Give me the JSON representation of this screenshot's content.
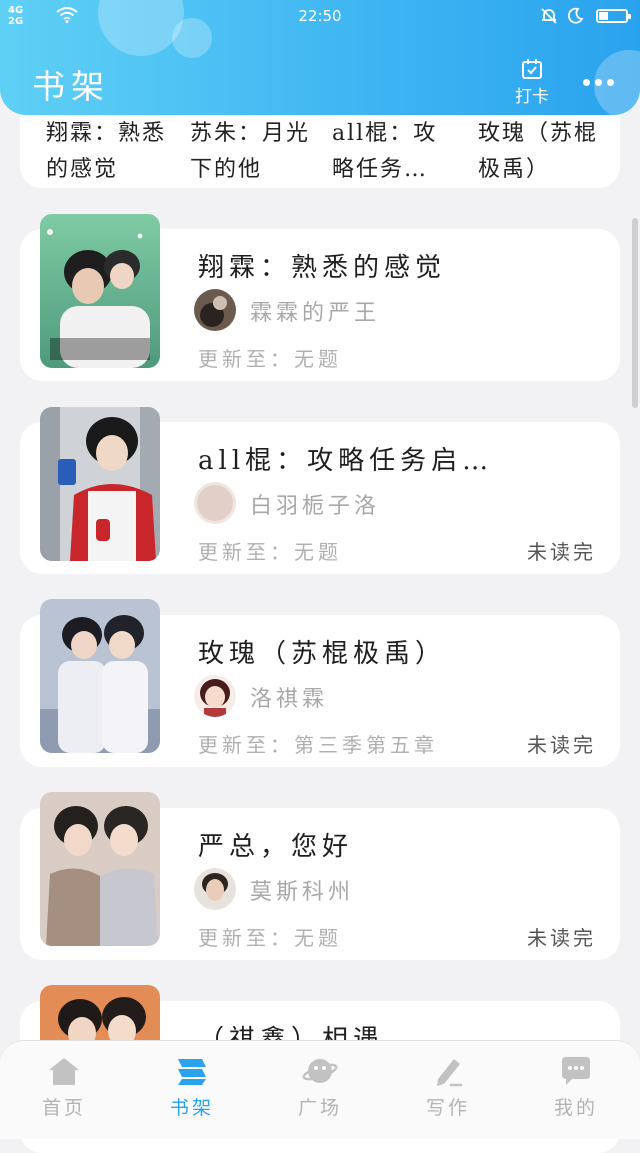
{
  "status": {
    "network": [
      "4G",
      "2G"
    ],
    "time": "22:50"
  },
  "header": {
    "title": "书架",
    "checkin_label": "打卡"
  },
  "top_partial": {
    "columns": [
      "翔霖：熟悉的感觉",
      "苏朱：月光下的他",
      "all棍：攻略任务…",
      "玫瑰（苏棍极禹）"
    ]
  },
  "books": [
    {
      "title": "翔霖：熟悉的感觉",
      "author": "霖霖的严王",
      "update": "更新至：无题",
      "unread": ""
    },
    {
      "title": "all棍：攻略任务启…",
      "author": "白羽栀子洛",
      "update": "更新至：无题",
      "unread": "未读完"
    },
    {
      "title": "玫瑰（苏棍极禹）",
      "author": "洛祺霖",
      "update": "更新至：第三季第五章",
      "unread": "未读完"
    },
    {
      "title": "严总，您好",
      "author": "莫斯科州",
      "update": "更新至：无题",
      "unread": "未读完"
    },
    {
      "title": "（祺鑫）相遇",
      "author": "",
      "update": "",
      "unread": ""
    }
  ],
  "nav": [
    {
      "label": "首页",
      "icon": "home-icon"
    },
    {
      "label": "书架",
      "icon": "bookshelf-icon"
    },
    {
      "label": "广场",
      "icon": "planet-icon"
    },
    {
      "label": "写作",
      "icon": "pen-icon"
    },
    {
      "label": "我的",
      "icon": "chat-icon"
    }
  ],
  "colors": {
    "accent": "#2aa3ee",
    "header_start": "#5fd0f5",
    "header_end": "#2aa3ee"
  }
}
